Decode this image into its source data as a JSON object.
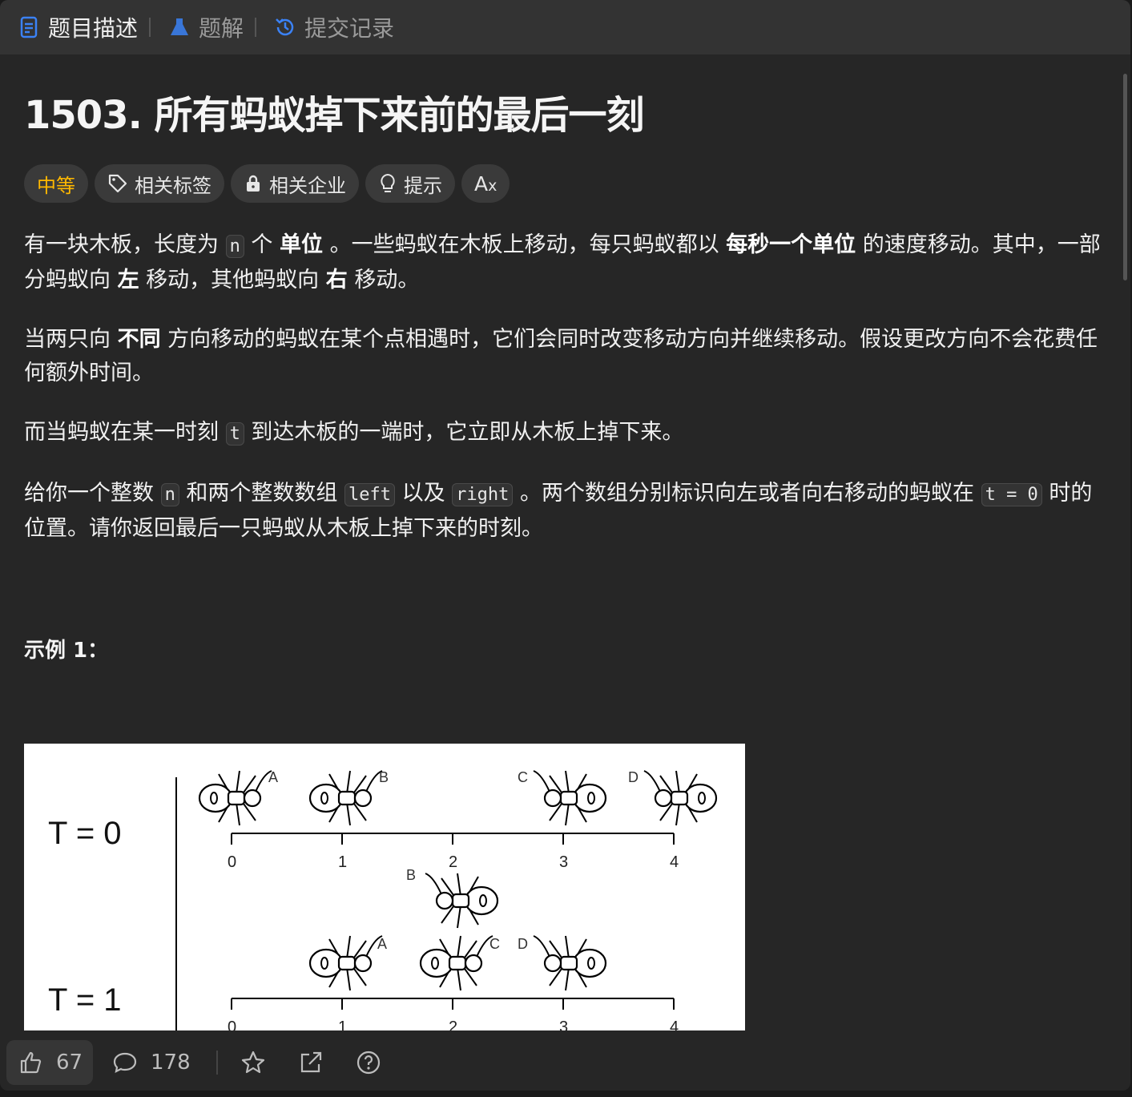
{
  "tabs": [
    {
      "label": "题目描述",
      "icon": "document-icon",
      "active": true
    },
    {
      "label": "题解",
      "icon": "flask-icon",
      "active": false
    },
    {
      "label": "提交记录",
      "icon": "history-icon",
      "active": false
    }
  ],
  "problem": {
    "title": "1503. 所有蚂蚁掉下来前的最后一刻",
    "difficulty": "中等",
    "tags": [
      "相关标签",
      "相关企业",
      "提示"
    ],
    "translate_label": "A"
  },
  "description": {
    "p1": {
      "t1": "有一块木板，长度为 ",
      "c1": "n",
      "t2": " 个 ",
      "b1": "单位",
      "t3": " 。一些蚂蚁在木板上移动，每只蚂蚁都以 ",
      "b2": "每秒一个单位",
      "t4": " 的速度移动。其中，一部分蚂蚁向 ",
      "b3": "左",
      "t5": " 移动，其他蚂蚁向 ",
      "b4": "右",
      "t6": " 移动。"
    },
    "p2": {
      "t1": "当两只向 ",
      "b1": "不同",
      "t2": " 方向移动的蚂蚁在某个点相遇时，它们会同时改变移动方向并继续移动。假设更改方向不会花费任何额外时间。"
    },
    "p3": {
      "t1": "而当蚂蚁在某一时刻 ",
      "c1": "t",
      "t2": " 到达木板的一端时，它立即从木板上掉下来。"
    },
    "p4": {
      "t1": "给你一个整数 ",
      "c1": "n",
      "t2": " 和两个整数数组 ",
      "c2": "left",
      "t3": " 以及 ",
      "c3": "right",
      "t4": " 。两个数组分别标识向左或者向右移动的蚂蚁在 ",
      "c4": "t = 0",
      "t5": " 时的位置。请你返回最后一只蚂蚁从木板上掉下来的时刻。"
    }
  },
  "example": {
    "heading": "示例 1：",
    "figure": {
      "t0_label": "T = 0",
      "t1_label": "T = 1",
      "ticks": [
        "0",
        "1",
        "2",
        "3",
        "4"
      ],
      "ants": [
        "A",
        "B",
        "C",
        "D"
      ]
    }
  },
  "bottom": {
    "likes": "67",
    "comments": "178"
  }
}
